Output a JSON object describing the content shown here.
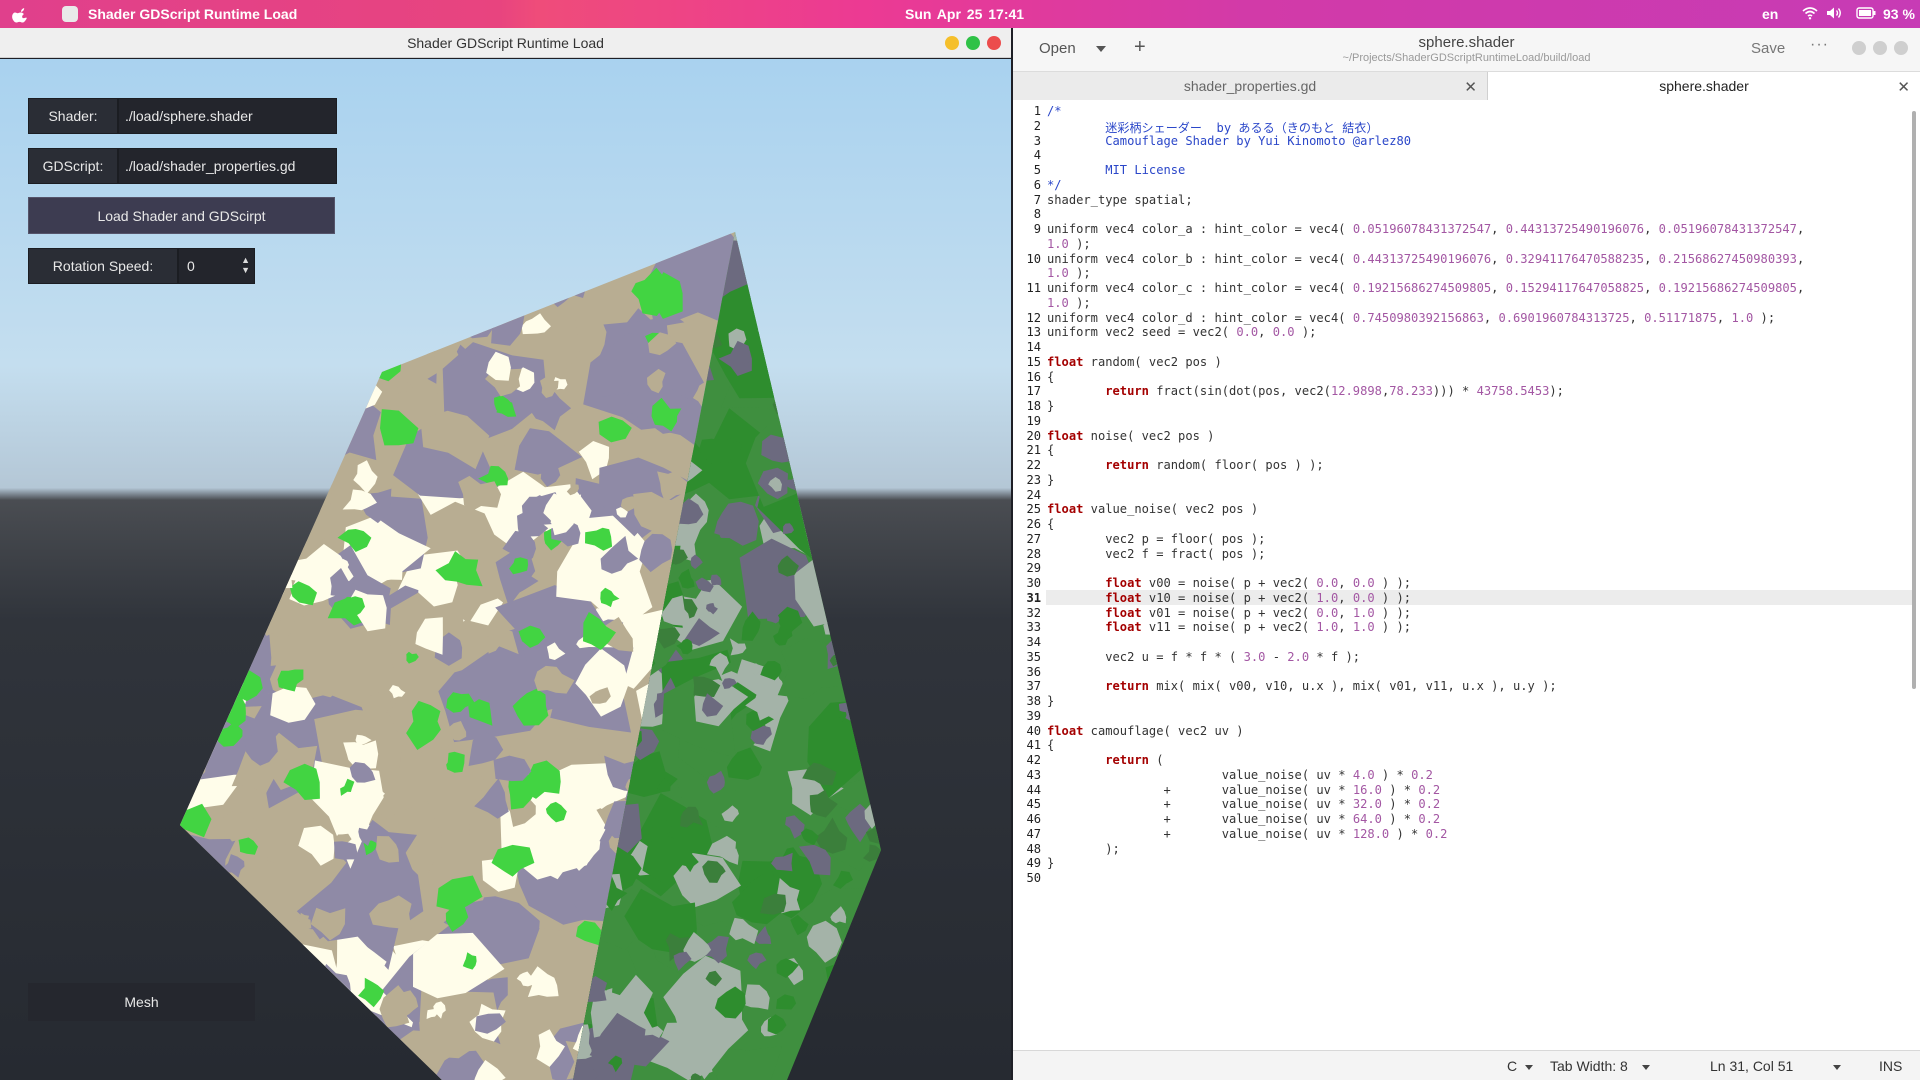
{
  "topbar": {
    "app_name": "Shader GDScript Runtime Load",
    "clock": "Sun Apr 25  17:41",
    "language": "en",
    "battery": "93 %"
  },
  "left_window": {
    "title": "Shader GDScript Runtime Load",
    "shader_label": "Shader:",
    "shader_path": "./load/sphere.shader",
    "gdscript_label": "GDScript:",
    "gdscript_path": "./load/shader_properties.gd",
    "load_button": "Load Shader and GDScirpt",
    "rotation_label": "Rotation Speed:",
    "rotation_value": "0",
    "mesh_button": "Mesh",
    "colors": {
      "camo_a": "#0d710d",
      "camo_b": "#715437",
      "camo_c": "#312731",
      "camo_d": "#beb083"
    }
  },
  "editor": {
    "open_label": "Open",
    "doc_title": "sphere.shader",
    "doc_path": "~/Projects/ShaderGDScriptRuntimeLoad/build/load",
    "save_label": "Save",
    "more_label": "···",
    "tabs": [
      {
        "label": "shader_properties.gd",
        "active": false
      },
      {
        "label": "sphere.shader",
        "active": true
      }
    ],
    "current_line": 31,
    "lines": [
      "1|/*",
      "2|        迷彩柄シェーダー  by あるる（きのもと 結衣）",
      "3|        Camouflage Shader by Yui Kinomoto @arlez80",
      "4|",
      "5|        MIT License",
      "6|*/",
      "7|shader_type spatial;",
      "8|",
      "9|uniform vec4 color_a : hint_color = vec4( 0.05196078431372547, 0.44313725490196076, 0.05196078431372547,",
      "|1.0 );",
      "10|uniform vec4 color_b : hint_color = vec4( 0.44313725490196076, 0.32941176470588235, 0.21568627450980393,",
      "|1.0 );",
      "11|uniform vec4 color_c : hint_color = vec4( 0.19215686274509805, 0.15294117647058825, 0.19215686274509805,",
      "|1.0 );",
      "12|uniform vec4 color_d : hint_color = vec4( 0.7450980392156863, 0.6901960784313725, 0.51171875, 1.0 );",
      "13|uniform vec2 seed = vec2( 0.0, 0.0 );",
      "14|",
      "15|float random( vec2 pos )",
      "16|{",
      "17|        return fract(sin(dot(pos, vec2(12.9898,78.233))) * 43758.5453);",
      "18|}",
      "19|",
      "20|float noise( vec2 pos )",
      "21|{",
      "22|        return random( floor( pos ) );",
      "23|}",
      "24|",
      "25|float value_noise( vec2 pos )",
      "26|{",
      "27|        vec2 p = floor( pos );",
      "28|        vec2 f = fract( pos );",
      "29|",
      "30|        float v00 = noise( p + vec2( 0.0, 0.0 ) );",
      "31|        float v10 = noise( p + vec2( 1.0, 0.0 ) );",
      "32|        float v01 = noise( p + vec2( 0.0, 1.0 ) );",
      "33|        float v11 = noise( p + vec2( 1.0, 1.0 ) );",
      "34|",
      "35|        vec2 u = f * f * ( 3.0 - 2.0 * f );",
      "36|",
      "37|        return mix( mix( v00, v10, u.x ), mix( v01, v11, u.x ), u.y );",
      "38|}",
      "39|",
      "40|float camouflage( vec2 uv )",
      "41|{",
      "42|        return (",
      "43|                        value_noise( uv * 4.0 ) * 0.2",
      "44|                +       value_noise( uv * 16.0 ) * 0.2",
      "45|                +       value_noise( uv * 32.0 ) * 0.2",
      "46|                +       value_noise( uv * 64.0 ) * 0.2",
      "47|                +       value_noise( uv * 128.0 ) * 0.2",
      "48|        );",
      "49|}",
      "50|"
    ],
    "status": {
      "language": "C",
      "tab_width": "Tab Width: 8",
      "position": "Ln 31, Col 51",
      "mode": "INS"
    }
  }
}
